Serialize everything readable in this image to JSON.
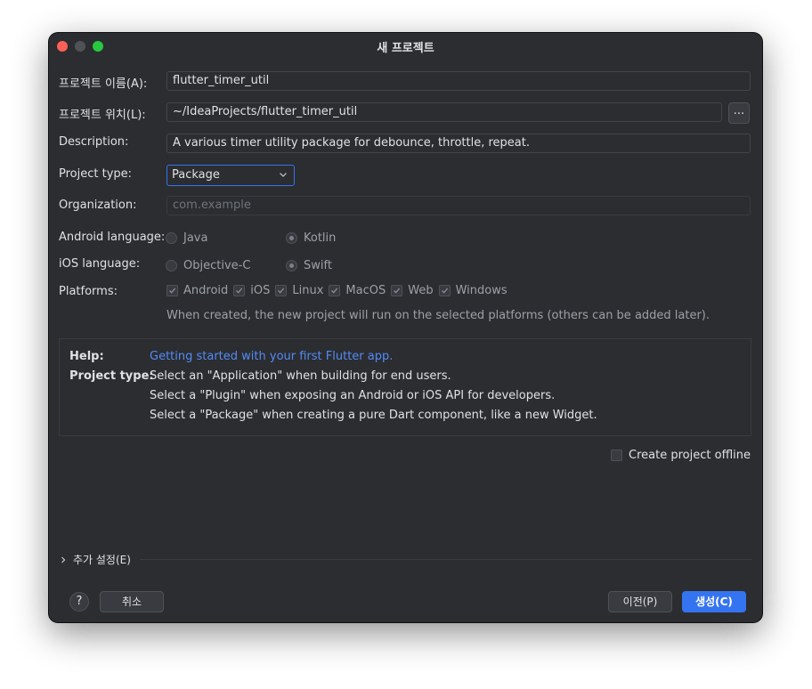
{
  "window": {
    "title": "새 프로젝트"
  },
  "form": {
    "name_label": "프로젝트 이름(A):",
    "name_value": "flutter_timer_util",
    "location_label": "프로젝트 위치(L):",
    "location_value": "~/IdeaProjects/flutter_timer_util",
    "browse_label": "...",
    "description_label": "Description:",
    "description_value": "A various timer utility package for debounce, throttle, repeat.",
    "project_type_label": "Project type:",
    "project_type_value": "Package",
    "organization_label": "Organization:",
    "organization_placeholder": "com.example",
    "android_language_label": "Android language:",
    "android_options": [
      {
        "label": "Java",
        "selected": false
      },
      {
        "label": "Kotlin",
        "selected": true
      }
    ],
    "ios_language_label": "iOS language:",
    "ios_options": [
      {
        "label": "Objective-C",
        "selected": false
      },
      {
        "label": "Swift",
        "selected": true
      }
    ],
    "platforms_label": "Platforms:",
    "platforms": [
      {
        "label": "Android",
        "checked": true
      },
      {
        "label": "iOS",
        "checked": true
      },
      {
        "label": "Linux",
        "checked": true
      },
      {
        "label": "MacOS",
        "checked": true
      },
      {
        "label": "Web",
        "checked": true
      },
      {
        "label": "Windows",
        "checked": true
      }
    ],
    "platforms_note": "When created, the new project will run on the selected platforms (others can be added later)."
  },
  "help": {
    "help_key": "Help:",
    "help_link": "Getting started with your first Flutter app.",
    "type_key": "Project type:",
    "lines": [
      "Select an \"Application\" when building for end users.",
      "Select a \"Plugin\" when exposing an Android or iOS API for developers.",
      "Select a \"Package\" when creating a pure Dart component, like a new Widget."
    ]
  },
  "offline": {
    "label": "Create project offline",
    "checked": false
  },
  "advanced": {
    "label": "추가 설정(E)"
  },
  "footer": {
    "help_label": "?",
    "cancel_label": "취소",
    "previous_label": "이전(P)",
    "create_label": "생성(C)"
  },
  "colors": {
    "background": "#2b2d30",
    "accent": "#3574f0",
    "link": "#548af7",
    "traffic_close": "#fe5f57",
    "traffic_max": "#28c840"
  }
}
